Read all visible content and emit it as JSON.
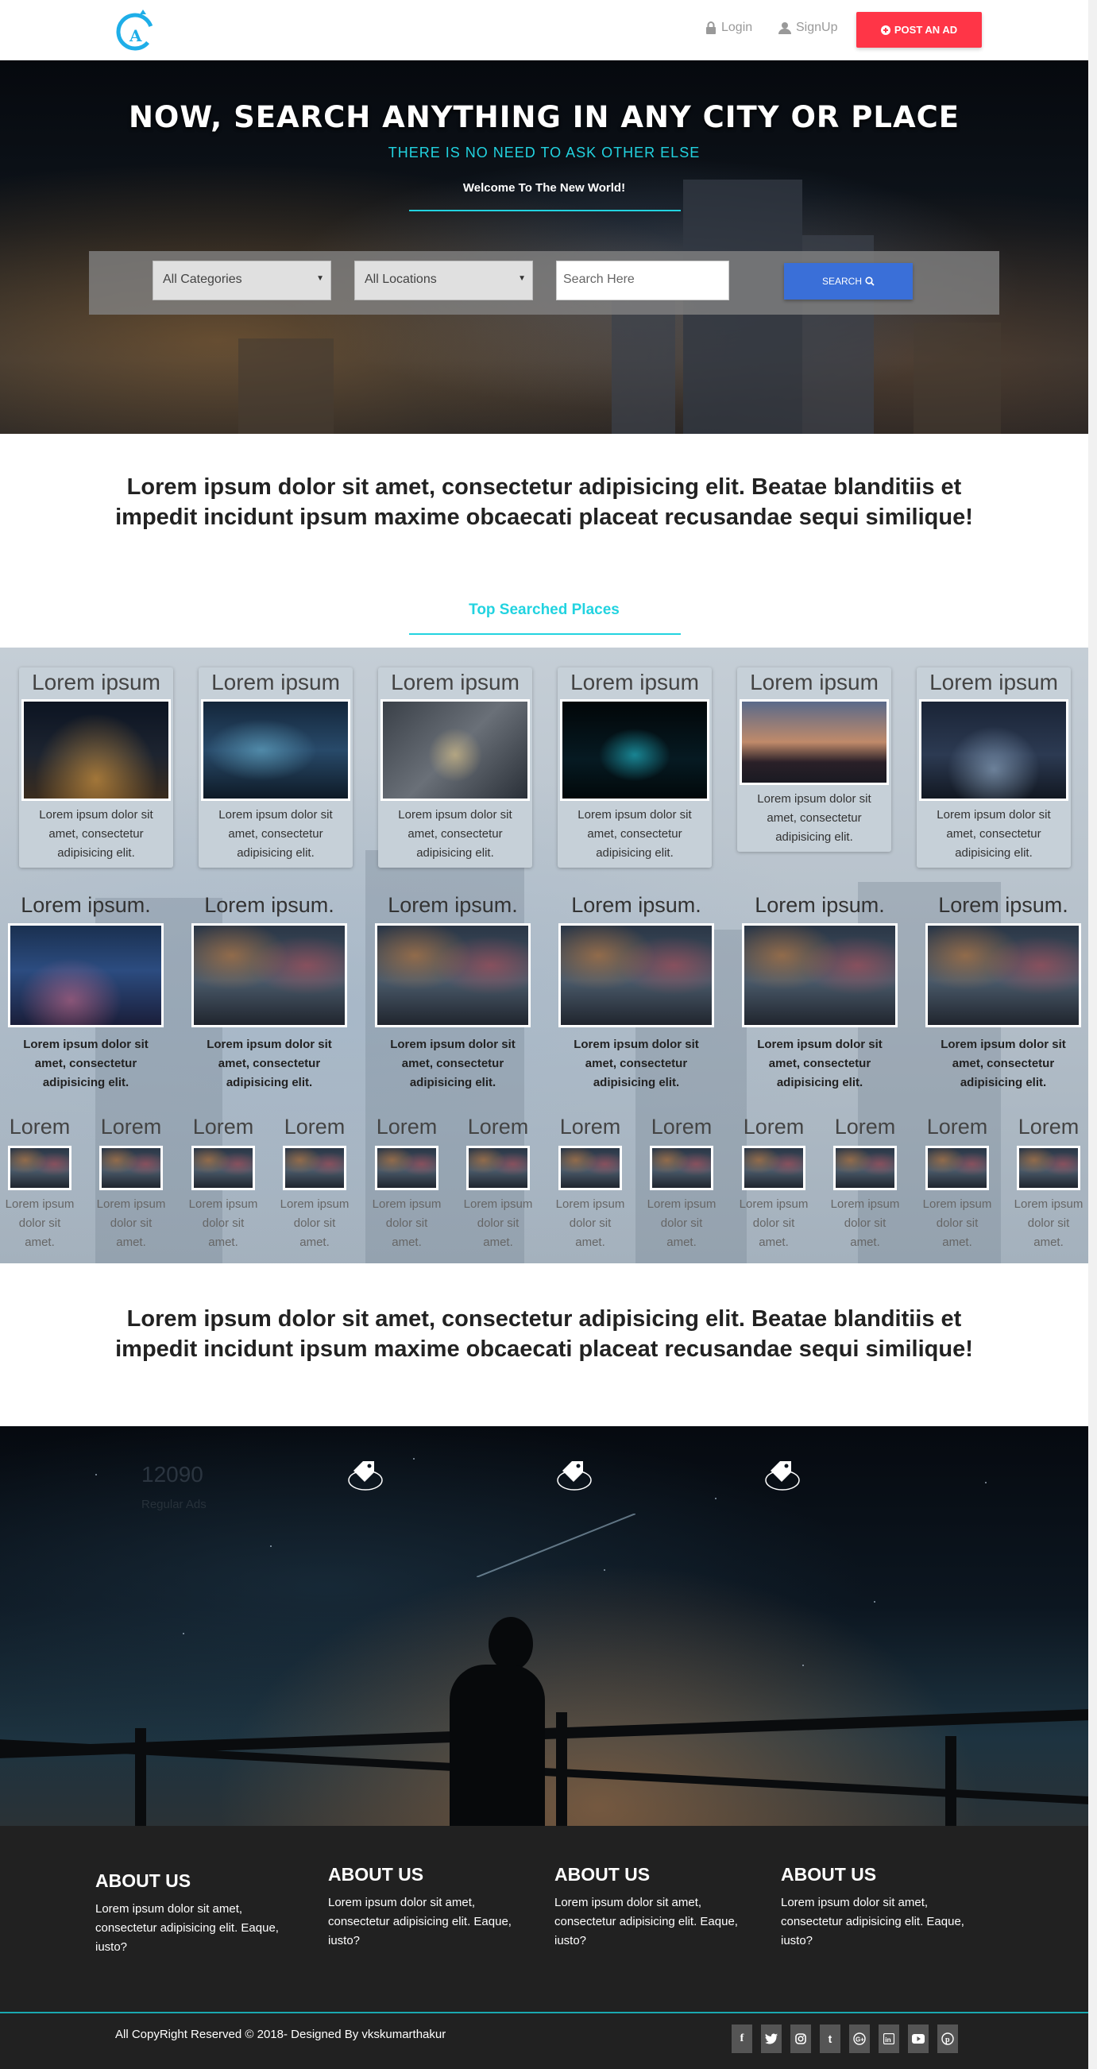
{
  "nav": {
    "login": "Login",
    "signup": "SignUp",
    "post_ad": "POST AN AD"
  },
  "hero": {
    "title": "NOW, SEARCH ANYTHING IN ANY CITY OR PLACE",
    "subtitle": "THERE IS NO NEED TO ASK OTHER ELSE",
    "welcome": "Welcome To The New World!",
    "category_select": "All Categories",
    "location_select": "All Locations",
    "search_placeholder": "Search Here",
    "search_button": "SEARCH"
  },
  "intro_text": "Lorem ipsum dolor sit amet, consectetur adipisicing elit. Beatae blanditiis et impedit incidunt ipsum maxime obcaecati placeat recusandae sequi similique!",
  "top_places_heading": "Top Searched Places",
  "gallery": {
    "row1": [
      {
        "title": "Lorem ipsum",
        "text": "Lorem ipsum dolor sit amet, consectetur adipisicing elit."
      },
      {
        "title": "Lorem ipsum",
        "text": "Lorem ipsum dolor sit amet, consectetur adipisicing elit."
      },
      {
        "title": "Lorem ipsum",
        "text": "Lorem ipsum dolor sit amet, consectetur adipisicing elit."
      },
      {
        "title": "Lorem ipsum",
        "text": "Lorem ipsum dolor sit amet, consectetur adipisicing elit."
      },
      {
        "title": "Lorem ipsum",
        "text": "Lorem ipsum dolor sit amet, consectetur adipisicing elit."
      },
      {
        "title": "Lorem ipsum",
        "text": "Lorem ipsum dolor sit amet, consectetur adipisicing elit."
      }
    ],
    "row2": [
      {
        "title": "Lorem ipsum.",
        "text": "Lorem ipsum dolor sit amet, consectetur adipisicing elit."
      },
      {
        "title": "Lorem ipsum.",
        "text": "Lorem ipsum dolor sit amet, consectetur adipisicing elit."
      },
      {
        "title": "Lorem ipsum.",
        "text": "Lorem ipsum dolor sit amet, consectetur adipisicing elit."
      },
      {
        "title": "Lorem ipsum.",
        "text": "Lorem ipsum dolor sit amet, consectetur adipisicing elit."
      },
      {
        "title": "Lorem ipsum.",
        "text": "Lorem ipsum dolor sit amet, consectetur adipisicing elit."
      },
      {
        "title": "Lorem ipsum.",
        "text": "Lorem ipsum dolor sit amet, consectetur adipisicing elit."
      }
    ],
    "row3": [
      {
        "title": "Lorem",
        "text": "Lorem ipsum dolor sit amet."
      },
      {
        "title": "Lorem",
        "text": "Lorem ipsum dolor sit amet."
      },
      {
        "title": "Lorem",
        "text": "Lorem ipsum dolor sit amet."
      },
      {
        "title": "Lorem",
        "text": "Lorem ipsum dolor sit amet."
      },
      {
        "title": "Lorem",
        "text": "Lorem ipsum dolor sit amet."
      },
      {
        "title": "Lorem",
        "text": "Lorem ipsum dolor sit amet."
      },
      {
        "title": "Lorem",
        "text": "Lorem ipsum dolor sit amet."
      },
      {
        "title": "Lorem",
        "text": "Lorem ipsum dolor sit amet."
      },
      {
        "title": "Lorem",
        "text": "Lorem ipsum dolor sit amet."
      },
      {
        "title": "Lorem",
        "text": "Lorem ipsum dolor sit amet."
      },
      {
        "title": "Lorem",
        "text": "Lorem ipsum dolor sit amet."
      },
      {
        "title": "Lorem",
        "text": "Lorem ipsum dolor sit amet."
      }
    ]
  },
  "stats": {
    "count": "12090",
    "label": "Regular Ads"
  },
  "footer": {
    "columns": [
      {
        "heading": "ABOUT US",
        "text": "Lorem ipsum dolor sit amet, consectetur adipisicing elit. Eaque, iusto?"
      },
      {
        "heading": "ABOUT US",
        "text": "Lorem ipsum dolor sit amet, consectetur adipisicing elit. Eaque, iusto?"
      },
      {
        "heading": "ABOUT US",
        "text": "Lorem ipsum dolor sit amet, consectetur adipisicing elit. Eaque, iusto?"
      },
      {
        "heading": "ABOUT US",
        "text": "Lorem ipsum dolor sit amet, consectetur adipisicing elit. Eaque, iusto?"
      }
    ],
    "copyright": "All CopyRight Reserved © 2018- Designed By vkskumarthakur"
  },
  "social_icons": [
    "facebook-icon",
    "twitter-icon",
    "instagram-icon",
    "tumblr-icon",
    "google-plus-icon",
    "linkedin-icon",
    "youtube-icon",
    "pinterest-icon"
  ],
  "colors": {
    "accent": "#22d3e0",
    "post_ad": "#ff3547",
    "search_button": "#3a6fd8",
    "footer": "#212121"
  }
}
